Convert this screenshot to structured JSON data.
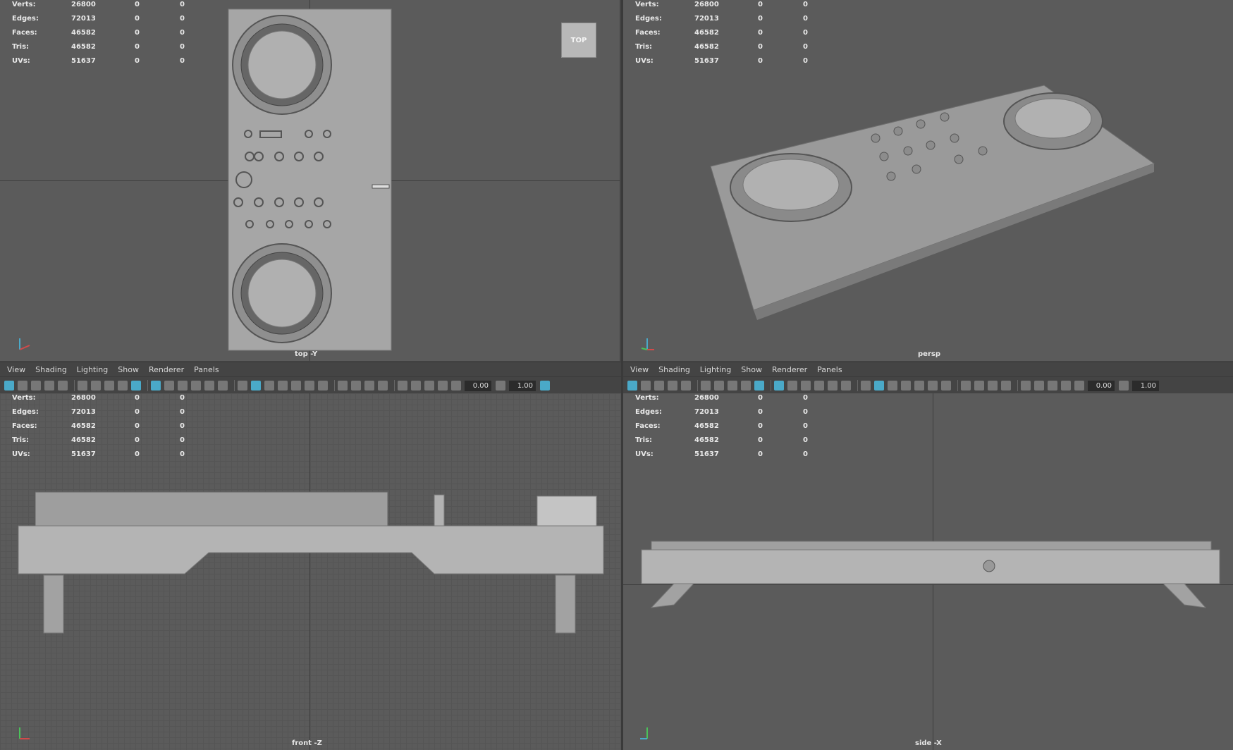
{
  "stats": [
    {
      "label": "Verts:",
      "values": [
        "26800",
        "0",
        "0"
      ]
    },
    {
      "label": "Edges:",
      "values": [
        "72013",
        "0",
        "0"
      ]
    },
    {
      "label": "Faces:",
      "values": [
        "46582",
        "0",
        "0"
      ]
    },
    {
      "label": "Tris:",
      "values": [
        "46582",
        "0",
        "0"
      ]
    },
    {
      "label": "UVs:",
      "values": [
        "51637",
        "0",
        "0"
      ]
    }
  ],
  "viewports": {
    "top": {
      "camera": "top -Y",
      "viewcube": "TOP"
    },
    "persp": {
      "camera": "persp"
    },
    "front": {
      "camera": "front -Z"
    },
    "side": {
      "camera": "side -X"
    }
  },
  "menu": [
    "View",
    "Shading",
    "Lighting",
    "Show",
    "Renderer",
    "Panels"
  ],
  "toolbar": {
    "value_a": "0.00",
    "value_b": "1.00"
  },
  "icons": [
    "camera-icon",
    "bookmark-icon",
    "grid-icon",
    "wireframe-icon",
    "smooth-shade-icon",
    "light-icon",
    "isolate-icon",
    "exposure-icon",
    "gamma-icon"
  ],
  "colors": {
    "viewport_bg": "#5b5b5b",
    "panel_bg": "#444444",
    "accent": "#4aa9c8"
  }
}
